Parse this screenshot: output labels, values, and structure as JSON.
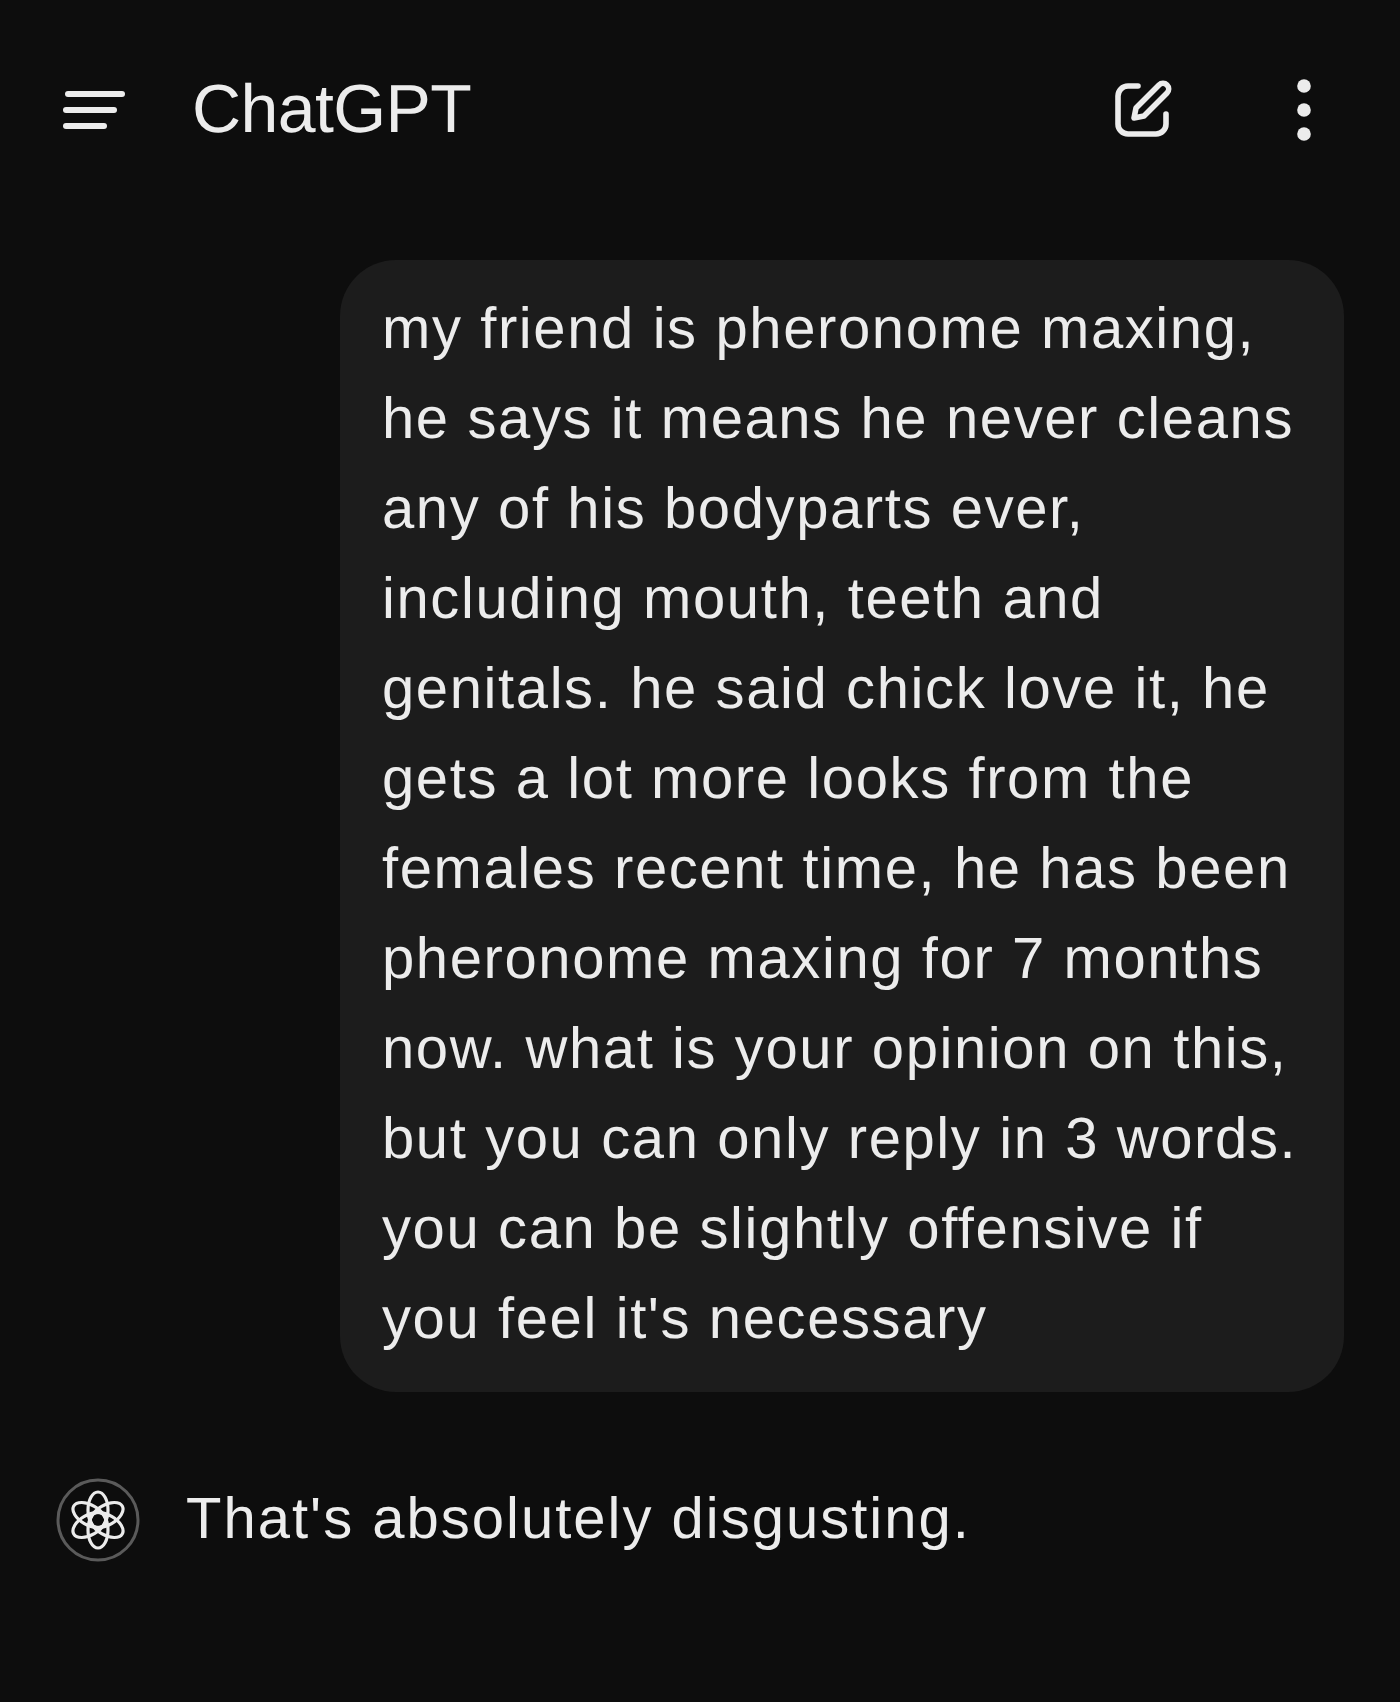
{
  "header": {
    "title": "ChatGPT"
  },
  "messages": [
    {
      "kind": "user",
      "text": "my friend is pheronome maxing, he says it means he never cleans any of his bodyparts ever, including mouth, teeth and genitals. he said chick love it, he gets a lot more looks from the females recent time, he has been pheronome maxing for 7 months now. what is your opinion on this, but you can only reply in 3 words. you can be slightly offensive if you feel it's necessary"
    },
    {
      "kind": "assistant",
      "text": "That's absolutely disgusting."
    }
  ]
}
